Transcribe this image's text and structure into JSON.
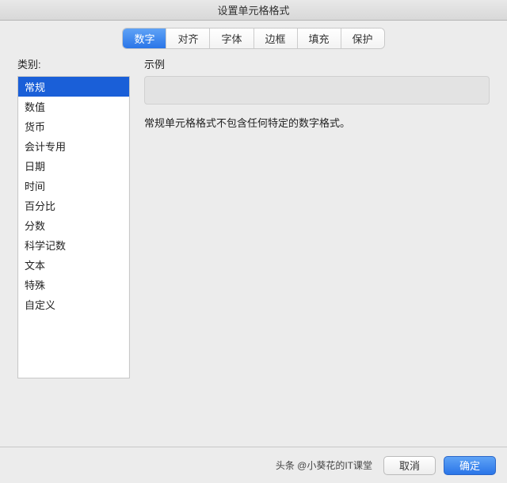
{
  "window": {
    "title": "设置单元格格式"
  },
  "tabs": [
    {
      "label": "数字",
      "active": true
    },
    {
      "label": "对齐",
      "active": false
    },
    {
      "label": "字体",
      "active": false
    },
    {
      "label": "边框",
      "active": false
    },
    {
      "label": "填充",
      "active": false
    },
    {
      "label": "保护",
      "active": false
    }
  ],
  "labels": {
    "category": "类别:",
    "sample": "示例"
  },
  "categories": [
    {
      "label": "常规",
      "selected": true
    },
    {
      "label": "数值",
      "selected": false
    },
    {
      "label": "货币",
      "selected": false
    },
    {
      "label": "会计专用",
      "selected": false
    },
    {
      "label": "日期",
      "selected": false
    },
    {
      "label": "时间",
      "selected": false
    },
    {
      "label": "百分比",
      "selected": false
    },
    {
      "label": "分数",
      "selected": false
    },
    {
      "label": "科学记数",
      "selected": false
    },
    {
      "label": "文本",
      "selected": false
    },
    {
      "label": "特殊",
      "selected": false
    },
    {
      "label": "自定义",
      "selected": false
    }
  ],
  "description": "常规单元格格式不包含任何特定的数字格式。",
  "sample_value": "",
  "footer": {
    "attribution": "头条 @小葵花的IT课堂",
    "cancel": "取消",
    "ok": "确定"
  }
}
